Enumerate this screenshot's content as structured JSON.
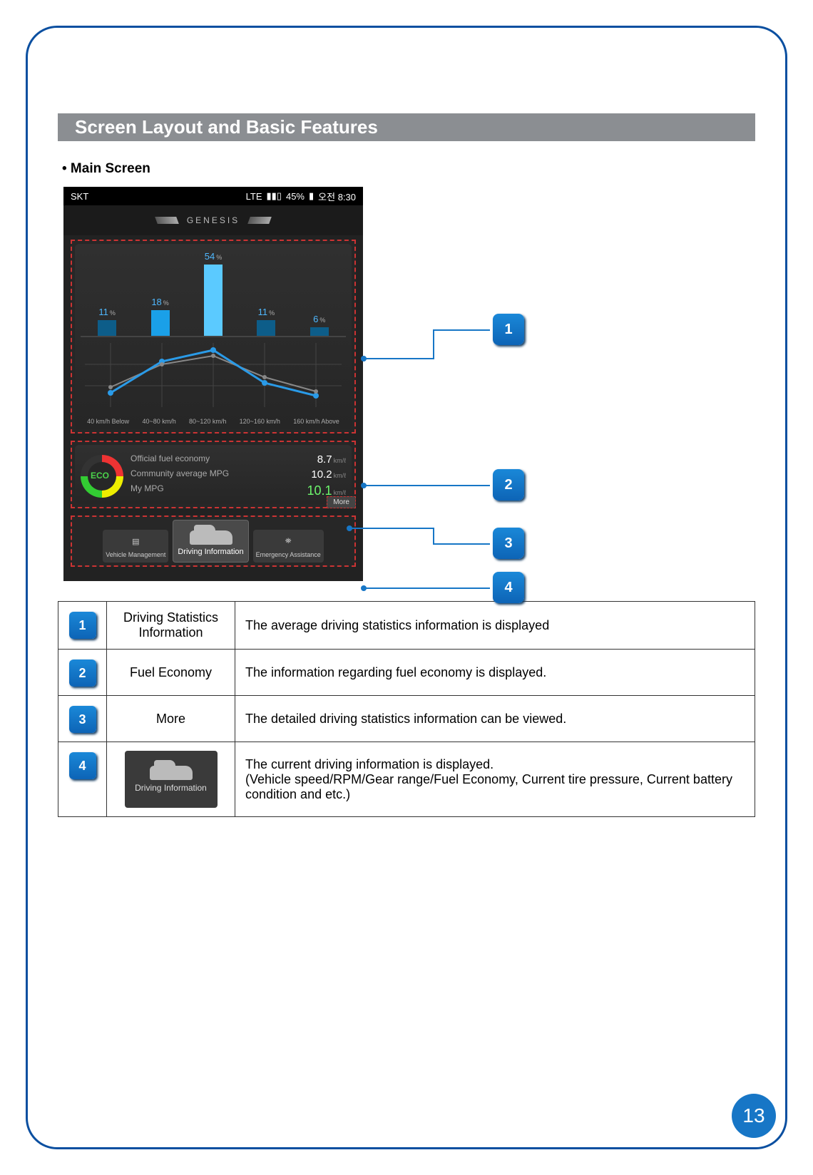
{
  "header": {
    "title": "Screen Layout and Basic Features"
  },
  "subheading": "• Main Screen",
  "statusbar": {
    "carrier": "SKT",
    "network": "LTE",
    "battery": "45%",
    "time": "오전 8:30"
  },
  "brand": "GENESIS",
  "chart_data": {
    "type": "bar",
    "categories": [
      "40 km/h Below",
      "40~80 km/h",
      "80~120 km/h",
      "120~160 km/h",
      "160 km/h Above"
    ],
    "values": [
      11,
      18,
      54,
      11,
      6
    ],
    "ylabel": "%",
    "ylim": [
      0,
      60
    ]
  },
  "eco": {
    "badge": "ECO",
    "rows": [
      {
        "label": "Official fuel economy",
        "value": "8.7",
        "unit": "km/ℓ"
      },
      {
        "label": "Community average MPG",
        "value": "10.2",
        "unit": "km/ℓ"
      },
      {
        "label": "My MPG",
        "value": "10.1",
        "unit": "km/ℓ"
      }
    ],
    "more": "More"
  },
  "tabs": {
    "left": "Vehicle Management",
    "main": "Driving Information",
    "right": "Emergency Assistance"
  },
  "callouts": [
    {
      "num": "1"
    },
    {
      "num": "2"
    },
    {
      "num": "3"
    },
    {
      "num": "4"
    }
  ],
  "legend": [
    {
      "num": "1",
      "name": "Driving Statistics Information",
      "desc": "The average driving statistics information is displayed"
    },
    {
      "num": "2",
      "name": "Fuel Economy",
      "desc": "The information regarding fuel economy is displayed."
    },
    {
      "num": "3",
      "name": "More",
      "desc": "The detailed driving statistics information can be viewed."
    },
    {
      "num": "4",
      "name": "",
      "desc": "The current driving information is displayed.\n(Vehicle speed/RPM/Gear range/Fuel Economy, Current tire pressure, Current battery condition and etc.)"
    }
  ],
  "legend_thumb_label": "Driving Information",
  "page_number": "13"
}
